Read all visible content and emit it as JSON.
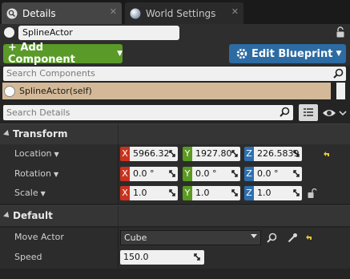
{
  "tabs": [
    {
      "label": "Details",
      "icon": "details-icon",
      "active": true
    },
    {
      "label": "World Settings",
      "icon": "globe-icon",
      "active": false
    }
  ],
  "actor": {
    "name": "SplineActor"
  },
  "buttons": {
    "add_component": "+ Add Component",
    "edit_blueprint": "Edit Blueprint"
  },
  "search_components": {
    "placeholder": "Search Components"
  },
  "tree": {
    "items": [
      {
        "label": "SplineActor(self)"
      }
    ]
  },
  "search_details": {
    "placeholder": "Search Details"
  },
  "categories": {
    "transform": "Transform",
    "default": "Default"
  },
  "transform": {
    "location": {
      "label": "Location",
      "x": "5966.32",
      "y": "1927.80",
      "z": "226.5839"
    },
    "rotation": {
      "label": "Rotation",
      "x": "0.0 °",
      "y": "0.0 °",
      "z": "0.0 °"
    },
    "scale": {
      "label": "Scale",
      "x": "1.0",
      "y": "1.0",
      "z": "1.0"
    }
  },
  "axis_labels": {
    "x": "X",
    "y": "Y",
    "z": "Z"
  },
  "default": {
    "move_actor": {
      "label": "Move Actor",
      "value": "Cube"
    },
    "speed": {
      "label": "Speed",
      "value": "150.0"
    }
  },
  "colors": {
    "add_green": "#5a9a29",
    "edit_blue": "#2d6ba3",
    "x_red": "#c8321e",
    "y_green": "#5a9a1e",
    "z_blue": "#2d6fb0",
    "selection_tan": "#d4b998",
    "reset_yellow": "#e8c82a"
  }
}
